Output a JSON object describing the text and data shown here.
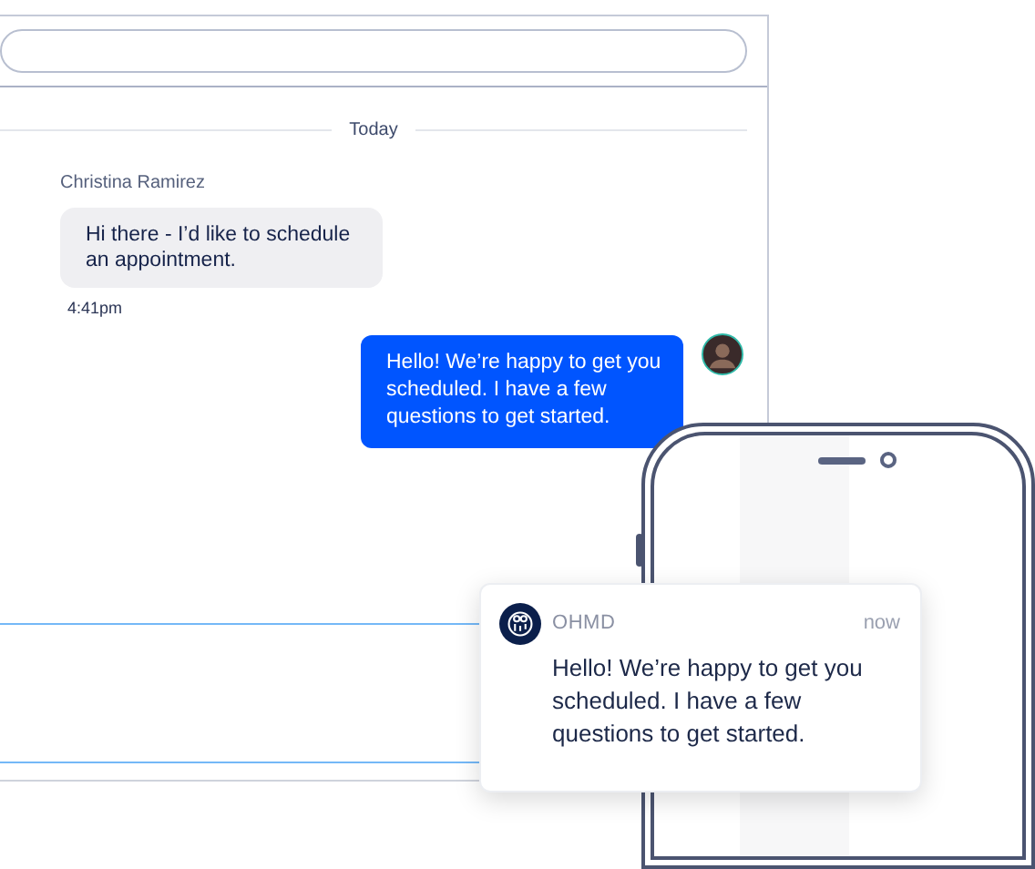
{
  "chat": {
    "date_divider": "Today",
    "messages": [
      {
        "kind": "incoming",
        "sender": "Christina Ramirez",
        "text": "Hi there - I’d like to schedule an appointment.",
        "time": "4:41pm"
      },
      {
        "kind": "outgoing",
        "text": "Hello! We’re happy to get you scheduled. I have a few questions to get started."
      }
    ]
  },
  "notification": {
    "app": "OHMD",
    "time": "now",
    "text": "Hello! We’re happy to get you scheduled. I have a few questions to get started."
  }
}
